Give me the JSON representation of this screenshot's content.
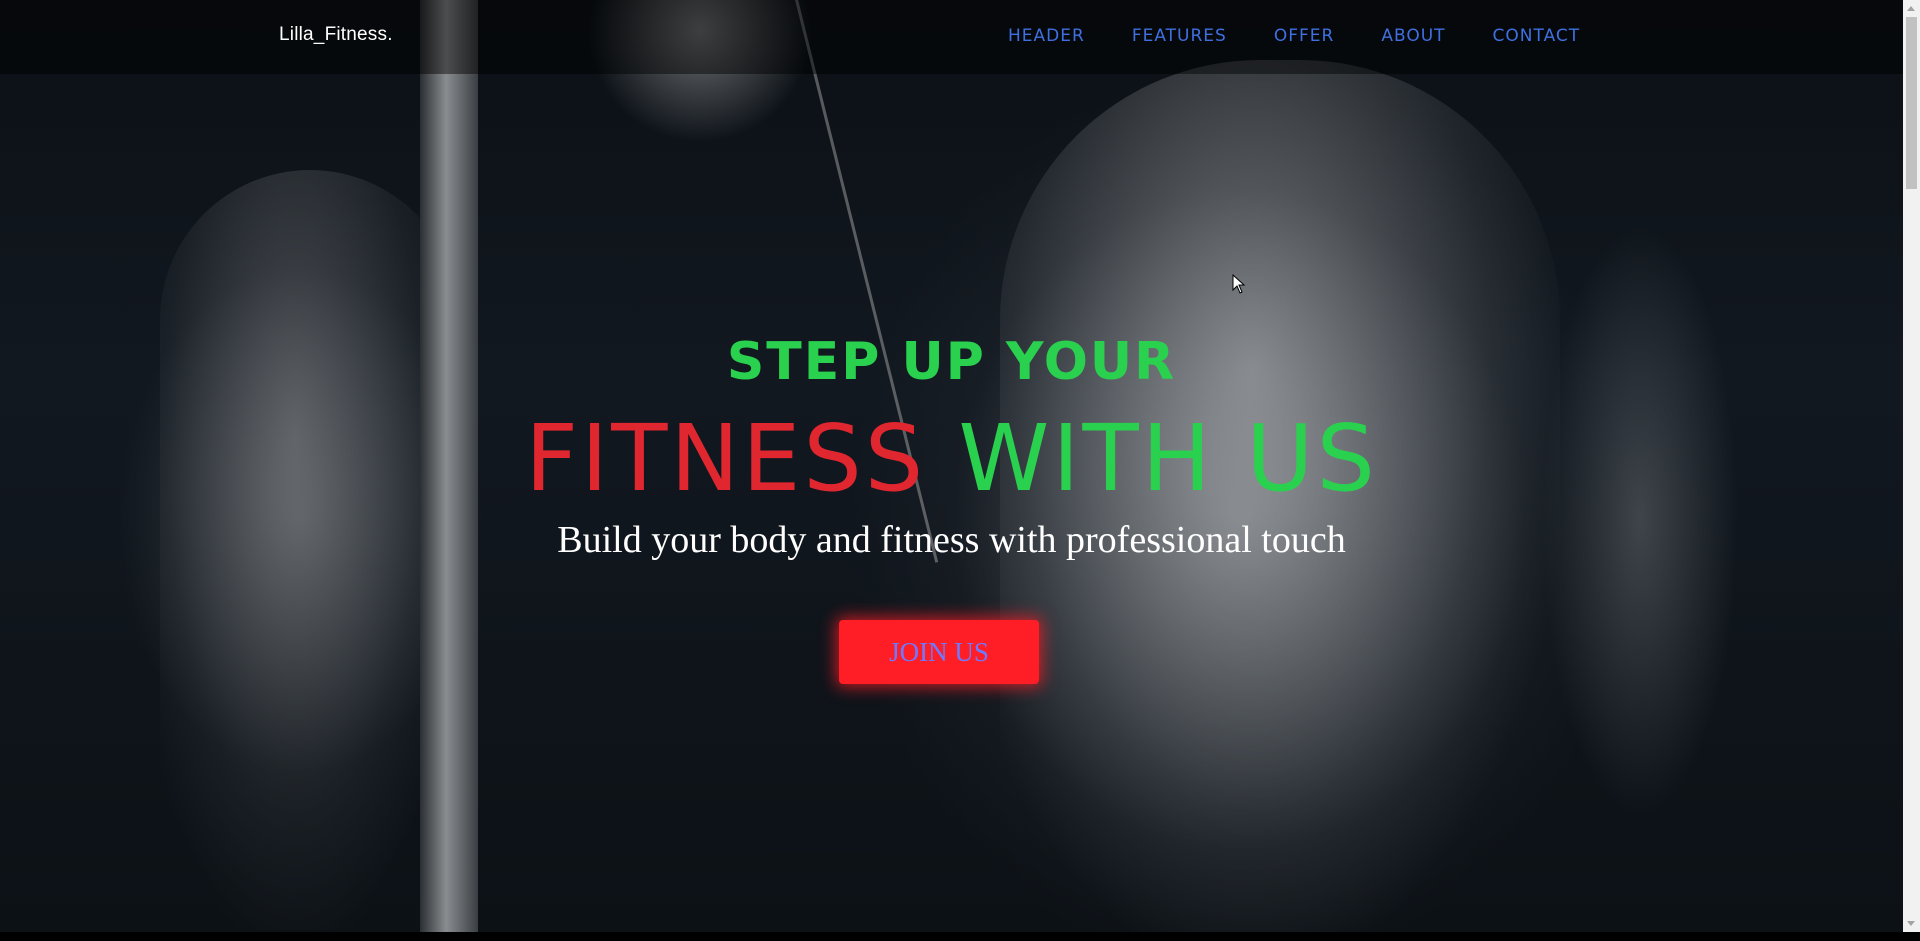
{
  "nav": {
    "brand": "Lilla_Fitness.",
    "links": [
      {
        "label": "HEADER"
      },
      {
        "label": "FEATURES"
      },
      {
        "label": "OFFER"
      },
      {
        "label": "ABOUT"
      },
      {
        "label": "CONTACT"
      }
    ],
    "link_color": "#3f6fe0"
  },
  "hero": {
    "line1": "STEP UP YOUR",
    "line2_red": "FITNESS",
    "line2_green": "WITH US",
    "subtitle": "Build your body and fitness with professional touch",
    "cta_label": "JOIN US",
    "colors": {
      "green": "#2ad14f",
      "red": "#e0262f",
      "button_bg": "#ff1d26",
      "button_text": "#6f79ff"
    }
  },
  "icons": {
    "cursor": "mouse-pointer-icon"
  }
}
